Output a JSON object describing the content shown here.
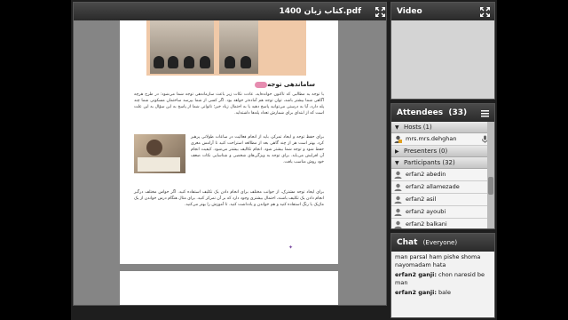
{
  "pdf_pod": {
    "title": "کتاب زبان 1400.pdf",
    "page": {
      "section_heading": "ساماندهی توجه",
      "paragraph1": "با توجه به مطالبی که تاکنون خوانده‌اید، عادت نکات زیر باعث سازماندهی توجه شما می‌شود: در طرح هرچه آگاهی شما بیشتر باشد، توان توجه هم آماده‌تر خواهد بود. اگر کسی از شما بپرسد ساختمان مسکونی شما چند پله دارد، آیا به درستی می‌توانید پاسخ دهید یا به احتمال زیاد خیر؛ ناتوانی شما از پاسخ به این سؤال به این علت است که از ابتدای برای شمارش تعداد پله‌ها داشته‌اید.",
      "paragraph2": "برای حفظ توجه و ایجاد تمرکز، باید از انجام فعالیت در ساعات طولانی پرهیز کرد. بهتر است هر از چند گاهی بعد از مطالعه استراحت کنید تا آرامش مغزی حفظ شود و توجه شما بیشتر شود. انجام تکالیف بیشتر می‌شود. کیفیت انجام آن افزایش می‌یابد. برای توجه به ویژگی‌های شخصی و شناسایی نکات ضعف خود روش مناسب یافت.",
      "paragraph3": "برای ایجاد توجه مشترک، از جوانب مختلف برای انجام دادن یک تکلیف استفاده کنید. اگر حواس مختلف درگیر انجام دادن یک تکلیف باشند، احتمال بیشتری وجود دارد که بر آن تمرکز کنید. برای مثال هنگام درس خواندن از یک ماژیک یا رنگ استفاده کنید و هم خواندن و یادداشت کنید. تا آموزش را بهتر می‌کنید."
    }
  },
  "video_pod": {
    "title": "Video"
  },
  "attendees_pod": {
    "title": "Attendees",
    "count": "(33)",
    "hosts_label": "Hosts (1)",
    "hosts": [
      "mrs.mrs.dehghan"
    ],
    "presenters_label": "Presenters (0)",
    "participants_label": "Participants (32)",
    "participants": [
      "erfan2 abedin",
      "erfan2 allamezade",
      "erfan2 asil",
      "erfan2 ayoubi",
      "erfan2 balkani"
    ]
  },
  "chat_pod": {
    "title": "Chat",
    "scope": "(Everyone)",
    "messages": [
      {
        "sender": "",
        "text": "man parsal ham pishe shoma nayomadam hata"
      },
      {
        "sender": "erfan2 ganji:",
        "text": "chon naresid be man"
      },
      {
        "sender": "erfan2 ganji:",
        "text": "bale"
      }
    ]
  },
  "colors": {
    "title_bar": "#333333",
    "pod_bg": "#d4d4d4",
    "pdf_bg": "#858585",
    "heading_pill": "#e68cb0"
  }
}
